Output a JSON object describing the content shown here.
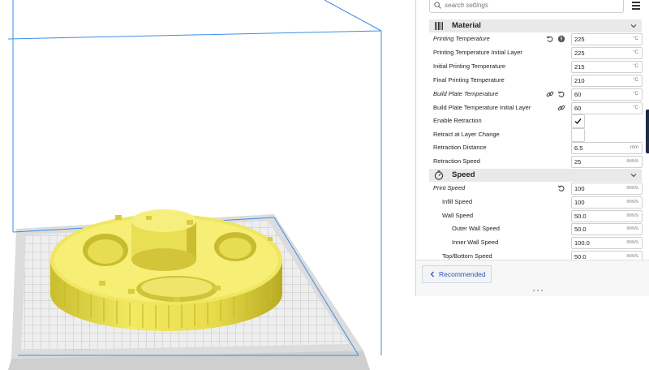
{
  "colors": {
    "model_yellow": "#f2ea6a",
    "bbox_blue": "#3b8ee8",
    "accent_blue": "#2d58b0",
    "category_bg": "#e9e9ec"
  },
  "search": {
    "placeholder": "search settings"
  },
  "icons": {
    "search": "search-icon",
    "menu": "hamburger-menu-icon",
    "material": "material-icon",
    "speed": "speed-gauge-icon",
    "reset": "reset-icon",
    "link": "link-icon",
    "info": "globe-icon",
    "check": "checkmark-icon",
    "back": "chevron-left-icon"
  },
  "material": {
    "title": "Material",
    "rows": [
      {
        "label": "Printing Temperature",
        "value": "225",
        "unit": "°C"
      },
      {
        "label": "Printing Temperature Initial Layer",
        "value": "225",
        "unit": "°C"
      },
      {
        "label": "Initial Printing Temperature",
        "value": "215",
        "unit": "°C"
      },
      {
        "label": "Final Printing Temperature",
        "value": "210",
        "unit": "°C"
      },
      {
        "label": "Build Plate Temperature",
        "value": "60",
        "unit": "°C"
      },
      {
        "label": "Build Plate Temperature Initial Layer",
        "value": "60",
        "unit": "°C"
      },
      {
        "label": "Enable Retraction",
        "checked": true
      },
      {
        "label": "Retract at Layer Change",
        "checked": false
      },
      {
        "label": "Retraction Distance",
        "value": "6.5",
        "unit": "mm"
      },
      {
        "label": "Retraction Speed",
        "value": "25",
        "unit": "mm/s"
      }
    ]
  },
  "speed": {
    "title": "Speed",
    "rows": [
      {
        "label": "Print Speed",
        "value": "100",
        "unit": "mm/s"
      },
      {
        "label": "Infill Speed",
        "value": "100",
        "unit": "mm/s"
      },
      {
        "label": "Wall Speed",
        "value": "50.0",
        "unit": "mm/s"
      },
      {
        "label": "Outer Wall Speed",
        "value": "50.0",
        "unit": "mm/s"
      },
      {
        "label": "Inner Wall Speed",
        "value": "100.0",
        "unit": "mm/s"
      },
      {
        "label": "Top/Bottom Speed",
        "value": "50.0",
        "unit": "mm/s"
      }
    ]
  },
  "footer": {
    "recommended_label": "Recommended"
  }
}
